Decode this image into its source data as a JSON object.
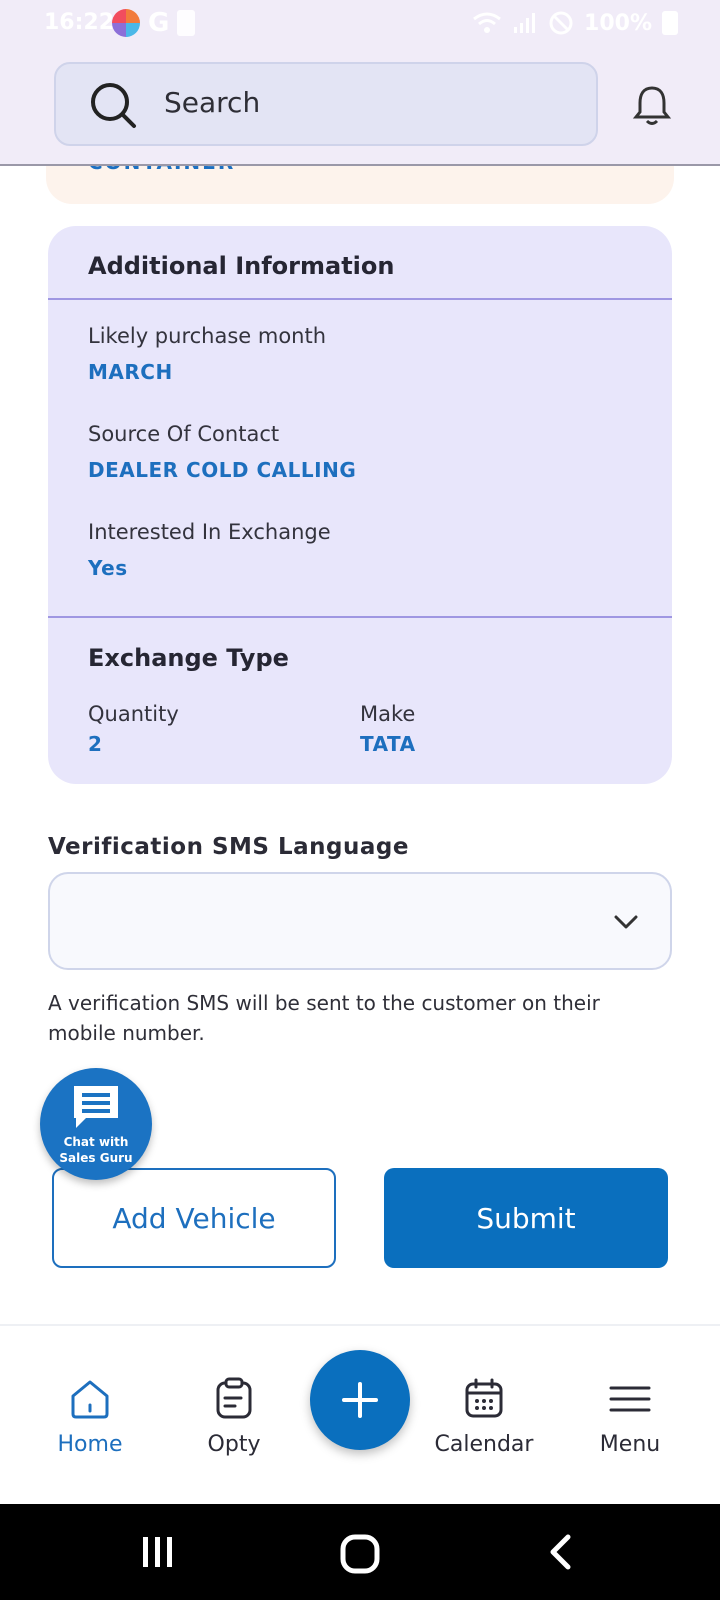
{
  "status_bar": {
    "time": "16:22",
    "battery": "100%"
  },
  "header": {
    "search_placeholder": "Search"
  },
  "top_card_partial_text": "CONTAINER",
  "additional_info": {
    "title": "Additional Information",
    "fields": [
      {
        "label": "Likely purchase month",
        "value": "MARCH"
      },
      {
        "label": "Source Of Contact",
        "value": "DEALER COLD CALLING"
      },
      {
        "label": "Interested In Exchange",
        "value": "Yes"
      }
    ],
    "exchange": {
      "title": "Exchange Type",
      "quantity_label": "Quantity",
      "quantity_value": "2",
      "make_label": "Make",
      "make_value": "TATA"
    }
  },
  "verification": {
    "label": "Verification SMS Language",
    "selected_value": "",
    "help_text": "A verification SMS will be sent to the customer on their mobile number."
  },
  "chat_fab": {
    "line1": "Chat with",
    "line2": "Sales Guru"
  },
  "actions": {
    "add_vehicle": "Add Vehicle",
    "submit": "Submit"
  },
  "bottom_nav": {
    "items": [
      {
        "label": "Home",
        "icon": "home-icon",
        "active": true
      },
      {
        "label": "Opty",
        "icon": "clipboard-icon",
        "active": false
      },
      {
        "label": "Calendar",
        "icon": "calendar-icon",
        "active": false
      },
      {
        "label": "Menu",
        "icon": "menu-icon",
        "active": false
      }
    ],
    "center_icon": "plus-icon"
  },
  "colors": {
    "primary": "#0a6fbe",
    "card_bg": "#e8e6fb",
    "header_bg": "#f1ecf8",
    "value_text": "#1d6fbe"
  }
}
